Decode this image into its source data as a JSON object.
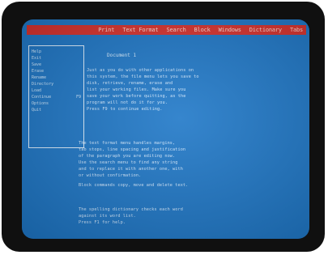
{
  "menubar": {
    "items": [
      "Print",
      "Text Format",
      "Search",
      "Block",
      "Windows",
      "Dictionary",
      "Tabs"
    ]
  },
  "sidebar": {
    "items": [
      {
        "label": "Help",
        "key": ""
      },
      {
        "label": "Exit",
        "key": ""
      },
      {
        "label": "Save",
        "key": ""
      },
      {
        "label": "Erase",
        "key": ""
      },
      {
        "label": "Rename",
        "key": ""
      },
      {
        "label": "Directory",
        "key": ""
      },
      {
        "label": "Load",
        "key": ""
      },
      {
        "label": "Continue",
        "key": "F9"
      },
      {
        "label": "Options",
        "key": ""
      },
      {
        "label": "Quit",
        "key": ""
      }
    ]
  },
  "document": {
    "title": "Document 1",
    "lines": [
      "  Just as you do with other applications on",
      "  this system, the file menu lets you save to",
      "  disk, retrieve, rename, erase and",
      "  list your working files. Make sure you",
      "  save your work before quitting, as the",
      "  program will not do it for you.",
      "  Press F9 to continue editing.",
      "",
      "  The text format menu handles margins,",
      "  tab stops, line spacing and justification",
      "  of the paragraph you are editing now.",
      "  Use the search menu to find any string",
      "  and to replace it with another one, with",
      "  or without confirmation.",
      "  Block commands copy, move and delete text.",
      "",
      "  The spelling dictionary checks each word",
      "  against its word list.",
      "  Press F1 for help."
    ]
  }
}
